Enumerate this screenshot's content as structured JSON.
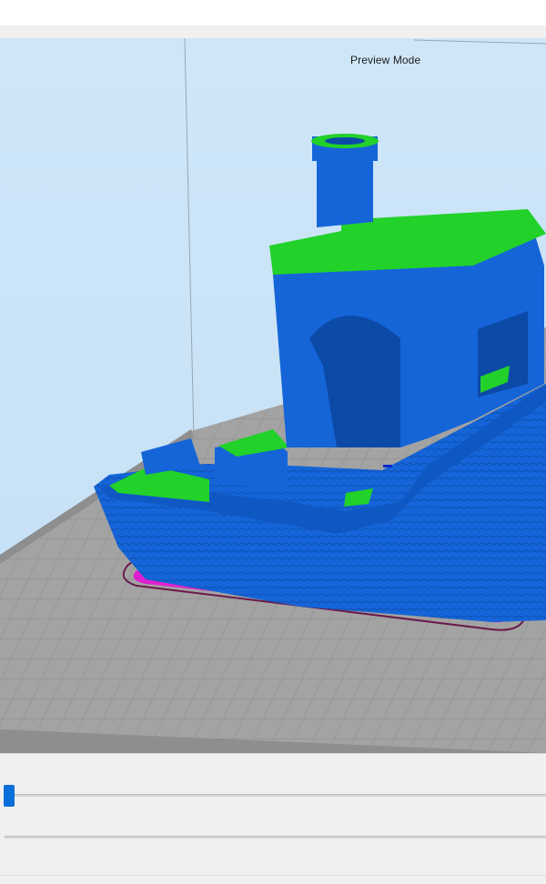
{
  "viewport": {
    "mode_label": "Preview Mode"
  },
  "model": {
    "colors": {
      "wall": "#1565d8",
      "top_skin": "#22d12a",
      "brim": "#e020d0",
      "skirt": "#6a1a4a",
      "background": "#cfe6f8",
      "bed": "#9a9a9a"
    }
  },
  "controls": {
    "layer_slider": {
      "position": 0.0
    },
    "speed_slider": {
      "position": 0.0
    }
  }
}
